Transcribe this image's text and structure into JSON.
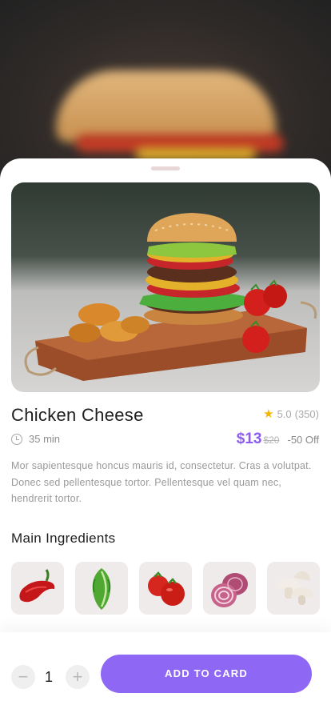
{
  "product": {
    "title": "Chicken Cheese",
    "rating": "5.0",
    "reviews": "(350)",
    "time": "35 min",
    "price": "$13",
    "old_price": "$20",
    "discount": "-50 Off",
    "description": "Mor sapientesque honcus mauris id, consectetur. Cras a volutpat. Donec sed pellentesque tortor. Pellentesque vel quam nec, hendrerit tortor."
  },
  "ingredients": {
    "title": "Main Ingredients",
    "items": [
      "chili-pepper",
      "lettuce",
      "tomato",
      "onion",
      "mushroom"
    ]
  },
  "cart": {
    "quantity": "1",
    "minus_label": "−",
    "plus_label": "+",
    "cta_label": "ADD TO CARD"
  },
  "colors": {
    "accent": "#8f67f5",
    "price": "#8c5cf0",
    "star": "#f4b400"
  }
}
